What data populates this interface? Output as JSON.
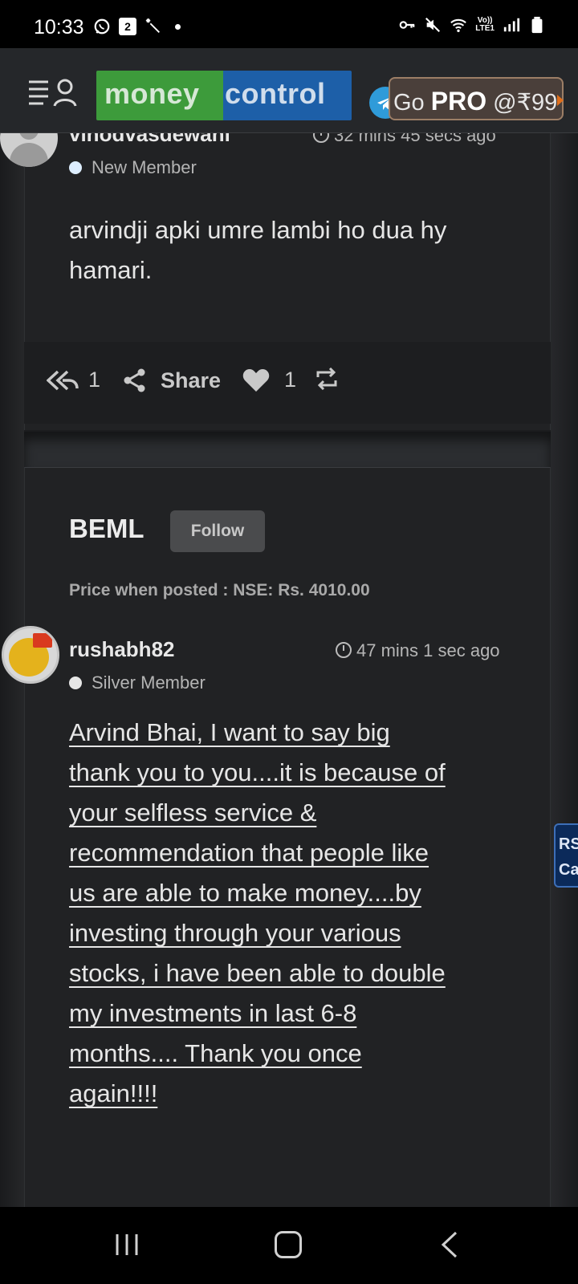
{
  "status_bar": {
    "time": "10:33",
    "calendar_day": "2",
    "network_label_top": "Vo))",
    "network_label_bottom": "LTE1"
  },
  "header": {
    "logo_part1": "money",
    "logo_part2": "control",
    "pro_prefix": "Go ",
    "pro_bold": "PRO",
    "pro_price": " @₹99",
    "colors": {
      "logo_green": "#3d9b3b",
      "logo_blue": "#1d5fa8",
      "pro_border": "#9c7e66"
    }
  },
  "post1": {
    "username": "vinodvasdewani",
    "time": "32 mins 45 secs ago",
    "badge": "New Member",
    "badge_color": "#ddeeff",
    "message": "arvindji apki umre lambi ho dua hy hamari.",
    "reply_count": "1",
    "share_label": "Share",
    "like_count": "1"
  },
  "post2": {
    "stock": "BEML",
    "follow_label": "Follow",
    "price_posted": "Price when posted : NSE: Rs. 4010.00",
    "username": "rushabh82",
    "time": "47 mins 1 sec ago",
    "badge": "Silver Member",
    "badge_color": "#e6e6e6",
    "message_lines": [
      "Arvind Bhai, I want to say big",
      "thank you to you....it is because of",
      "your selfless service &",
      "recommendation that people like",
      "us are able to make money....by",
      "investing through your various",
      "stocks, i have been able to double",
      "my investments in last 6-8",
      "months.... Thank you once",
      "again!!!!"
    ]
  },
  "side_tab": {
    "line1": "RS",
    "line2": "Ca"
  }
}
